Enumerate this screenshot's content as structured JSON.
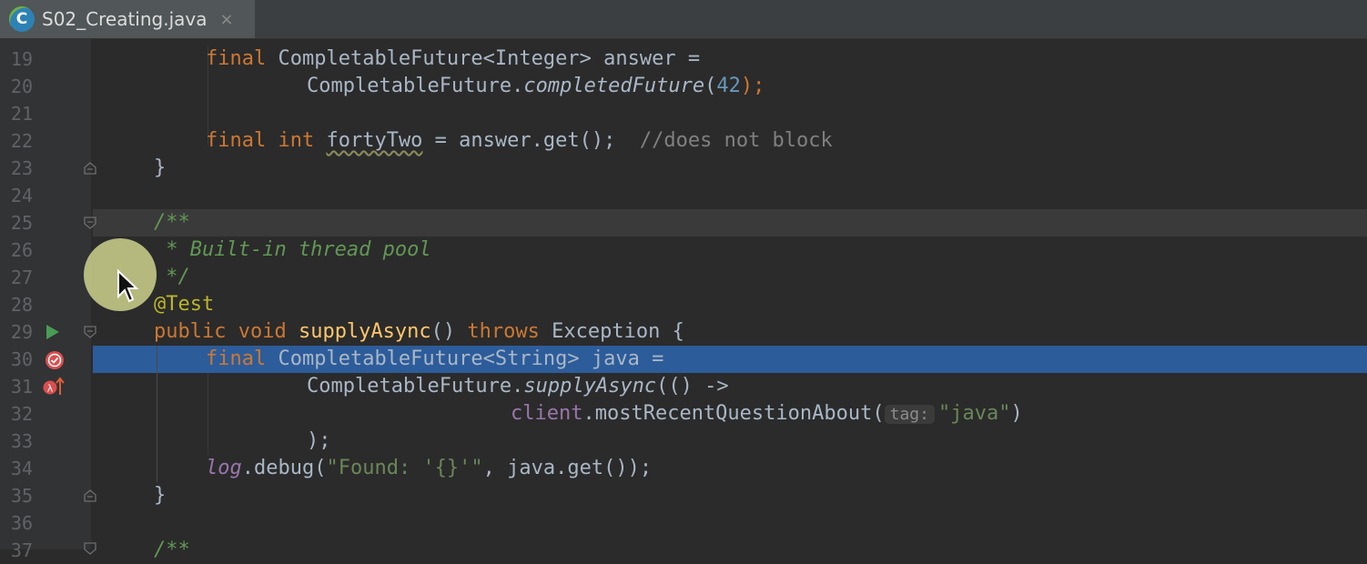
{
  "tab": {
    "icon_letter": "C",
    "title": "S02_Creating.java",
    "close": "×"
  },
  "colors": {
    "background": "#2b2b2b",
    "keyword": "#cc7832",
    "string": "#6a8759",
    "number": "#6897bb",
    "doc_comment": "#629755",
    "annotation": "#bbb529",
    "method": "#ffc66d",
    "selection": "#2d5c9a"
  },
  "lines": [
    {
      "n": "19",
      "k1": "final",
      "t1": " CompletableFuture<Integer> answer ="
    },
    {
      "n": "20",
      "t1": "CompletableFuture.",
      "m1": "completedFuture",
      "t2": "(",
      "num": "42",
      "t3": ");"
    },
    {
      "n": "21"
    },
    {
      "n": "22",
      "k1": "final int",
      "sp": " ",
      "w": "fortyTwo",
      "t1": " = answer.get();",
      "s": "  ",
      "c": "//does not block"
    },
    {
      "n": "23",
      "t1": "}"
    },
    {
      "n": "24"
    },
    {
      "n": "25",
      "d": "/**"
    },
    {
      "n": "26",
      "d": " * Built-in thread pool"
    },
    {
      "n": "27",
      "d": " */"
    },
    {
      "n": "28",
      "a": "@Test"
    },
    {
      "n": "29",
      "k1": "public void",
      "sp": " ",
      "f": "supplyAsync",
      "t1": "() ",
      "k2": "throws",
      "t2": " Exception {"
    },
    {
      "n": "30",
      "k1": "final",
      "t1": " CompletableFuture<String> java ="
    },
    {
      "n": "31",
      "t1": "CompletableFuture.",
      "m1": "supplyAsync",
      "t2": "(() ->"
    },
    {
      "n": "32",
      "fld": "client",
      "t1": ".mostRecentQuestionAbout(",
      "hint": "tag:",
      "str": "\"java\"",
      "t2": ")"
    },
    {
      "n": "33",
      "t1": ");"
    },
    {
      "n": "34",
      "fld": "log",
      "t1": ".debug(",
      "str": "\"Found: '{}'\"",
      "t2": ", java.get());"
    },
    {
      "n": "35",
      "t1": "}"
    },
    {
      "n": "36"
    },
    {
      "n": "37",
      "d": "/**"
    }
  ]
}
